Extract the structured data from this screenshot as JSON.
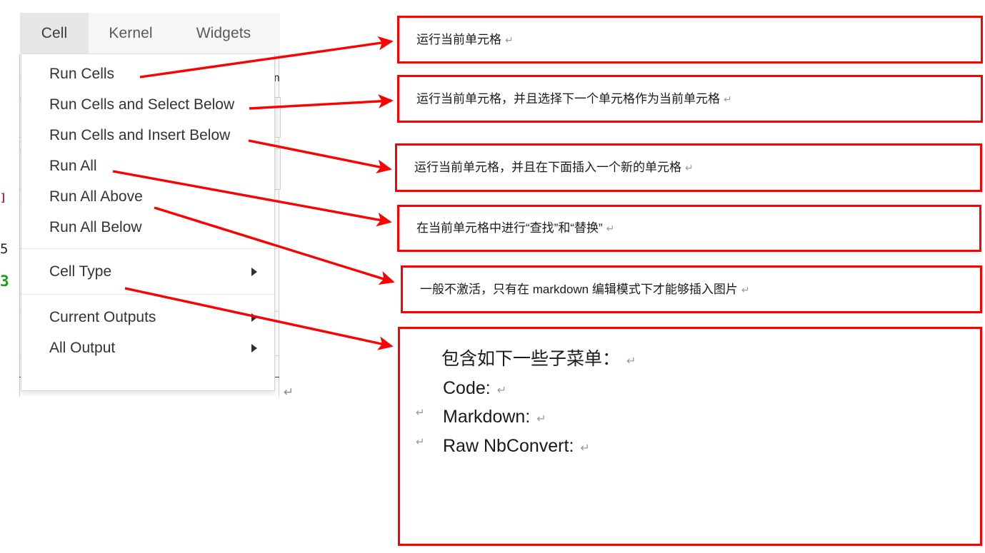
{
  "menubar": {
    "tabs": [
      {
        "label": "Cell",
        "active": true
      },
      {
        "label": "Kernel",
        "active": false
      },
      {
        "label": "Widgets",
        "active": false
      }
    ]
  },
  "cell_menu": {
    "run_group": [
      "Run Cells",
      "Run Cells and Select Below",
      "Run Cells and Insert Below",
      "Run All",
      "Run All Above",
      "Run All Below"
    ],
    "type_group": [
      {
        "label": "Cell Type",
        "has_submenu": true
      }
    ],
    "output_group": [
      {
        "label": "Current Outputs",
        "has_submenu": true
      },
      {
        "label": "All Output",
        "has_submenu": true
      }
    ],
    "trailing_mark": "↵"
  },
  "callouts": [
    {
      "id": "run-cells",
      "text": "运行当前单元格",
      "cr": "↵"
    },
    {
      "id": "run-select-below",
      "text": "运行当前单元格，并且选择下一个单元格作为当前单元格",
      "cr": "↵"
    },
    {
      "id": "run-insert-below",
      "text": "运行当前单元格，并且在下面插入一个新的单元格",
      "cr": "↵"
    },
    {
      "id": "find-replace",
      "text": "在当前单元格中进行“查找”和“替换”",
      "cr": "↵"
    },
    {
      "id": "insert-image",
      "text": "一般不激活，只有在 markdown 编辑模式下才能够插入图片",
      "cr": "↵"
    }
  ],
  "celltype_detail": {
    "heading": "包含如下一些子菜单：",
    "heading_cr": "↵",
    "items": [
      {
        "label": "Code:",
        "cr": "↵",
        "lead": ""
      },
      {
        "label": "Markdown:",
        "cr": "↵",
        "lead": "↵"
      },
      {
        "label": "Raw NbConvert:",
        "cr": "↵",
        "lead": "↵"
      }
    ]
  },
  "notebook_fragments": [
    {
      "text": "n",
      "color": "dark"
    },
    {
      "text": "]:",
      "color": "red"
    },
    {
      "text": "5",
      "color": "dark"
    },
    {
      "text": "3",
      "color": "green"
    }
  ],
  "colors": {
    "annotation_border": "#ff0000",
    "arrow": "#ff0000",
    "menubar_bg": "#f7f7f7",
    "active_tab_bg": "#e7e7e7",
    "menu_text": "#333333"
  }
}
